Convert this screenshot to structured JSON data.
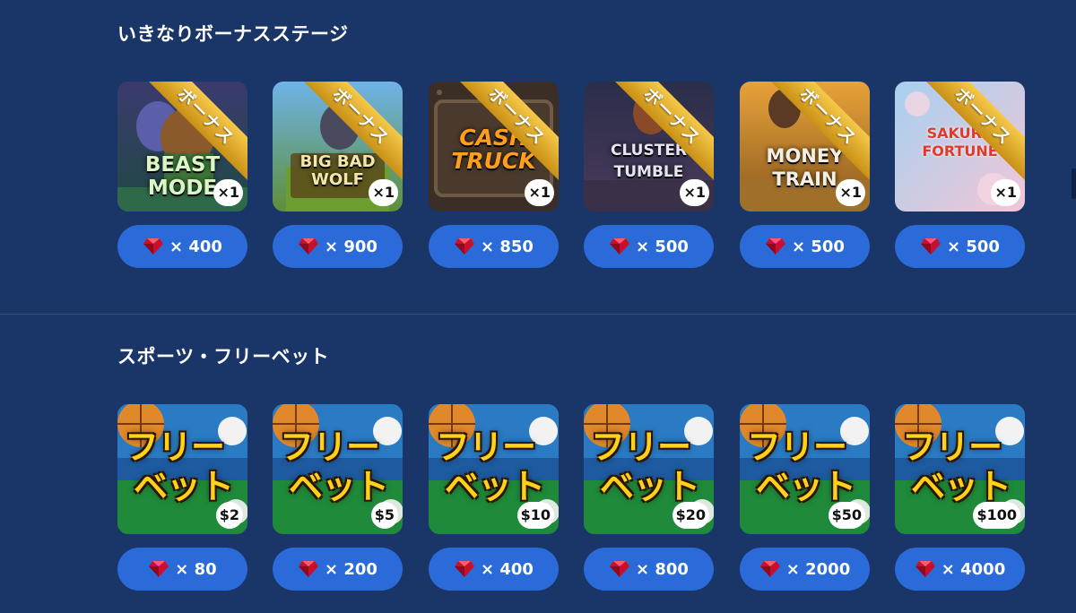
{
  "sections": [
    {
      "title": "いきなりボーナスステージ",
      "ribbon_label": "ボーナス",
      "items": [
        {
          "game_name": "BEAST MODE",
          "count": "×1",
          "price": "× 400"
        },
        {
          "game_name": "BIG BAD WOLF",
          "count": "×1",
          "price": "× 900"
        },
        {
          "game_name": "CASH TRUCK",
          "count": "×1",
          "price": "× 850"
        },
        {
          "game_name": "CLUSTER TUMBLE",
          "count": "×1",
          "price": "× 500"
        },
        {
          "game_name": "MONEY TRAIN",
          "count": "×1",
          "price": "× 500"
        },
        {
          "game_name": "SAKURA FORTUNE",
          "count": "×1",
          "price": "× 500"
        }
      ]
    },
    {
      "title": "スポーツ・フリーベット",
      "freebet_line1": "フリー",
      "freebet_line2": "ベット",
      "items": [
        {
          "amount": "$2",
          "price": "× 80"
        },
        {
          "amount": "$5",
          "price": "× 200"
        },
        {
          "amount": "$10",
          "price": "× 400"
        },
        {
          "amount": "$20",
          "price": "× 800"
        },
        {
          "amount": "$50",
          "price": "× 2000"
        },
        {
          "amount": "$100",
          "price": "× 4000"
        }
      ]
    }
  ],
  "icons": {
    "currency": "ruby-gem-icon"
  },
  "colors": {
    "background": "#1a3567",
    "price_button": "#2b6bd9",
    "ribbon": "#e0aa2b",
    "gem": "#c8102e"
  }
}
